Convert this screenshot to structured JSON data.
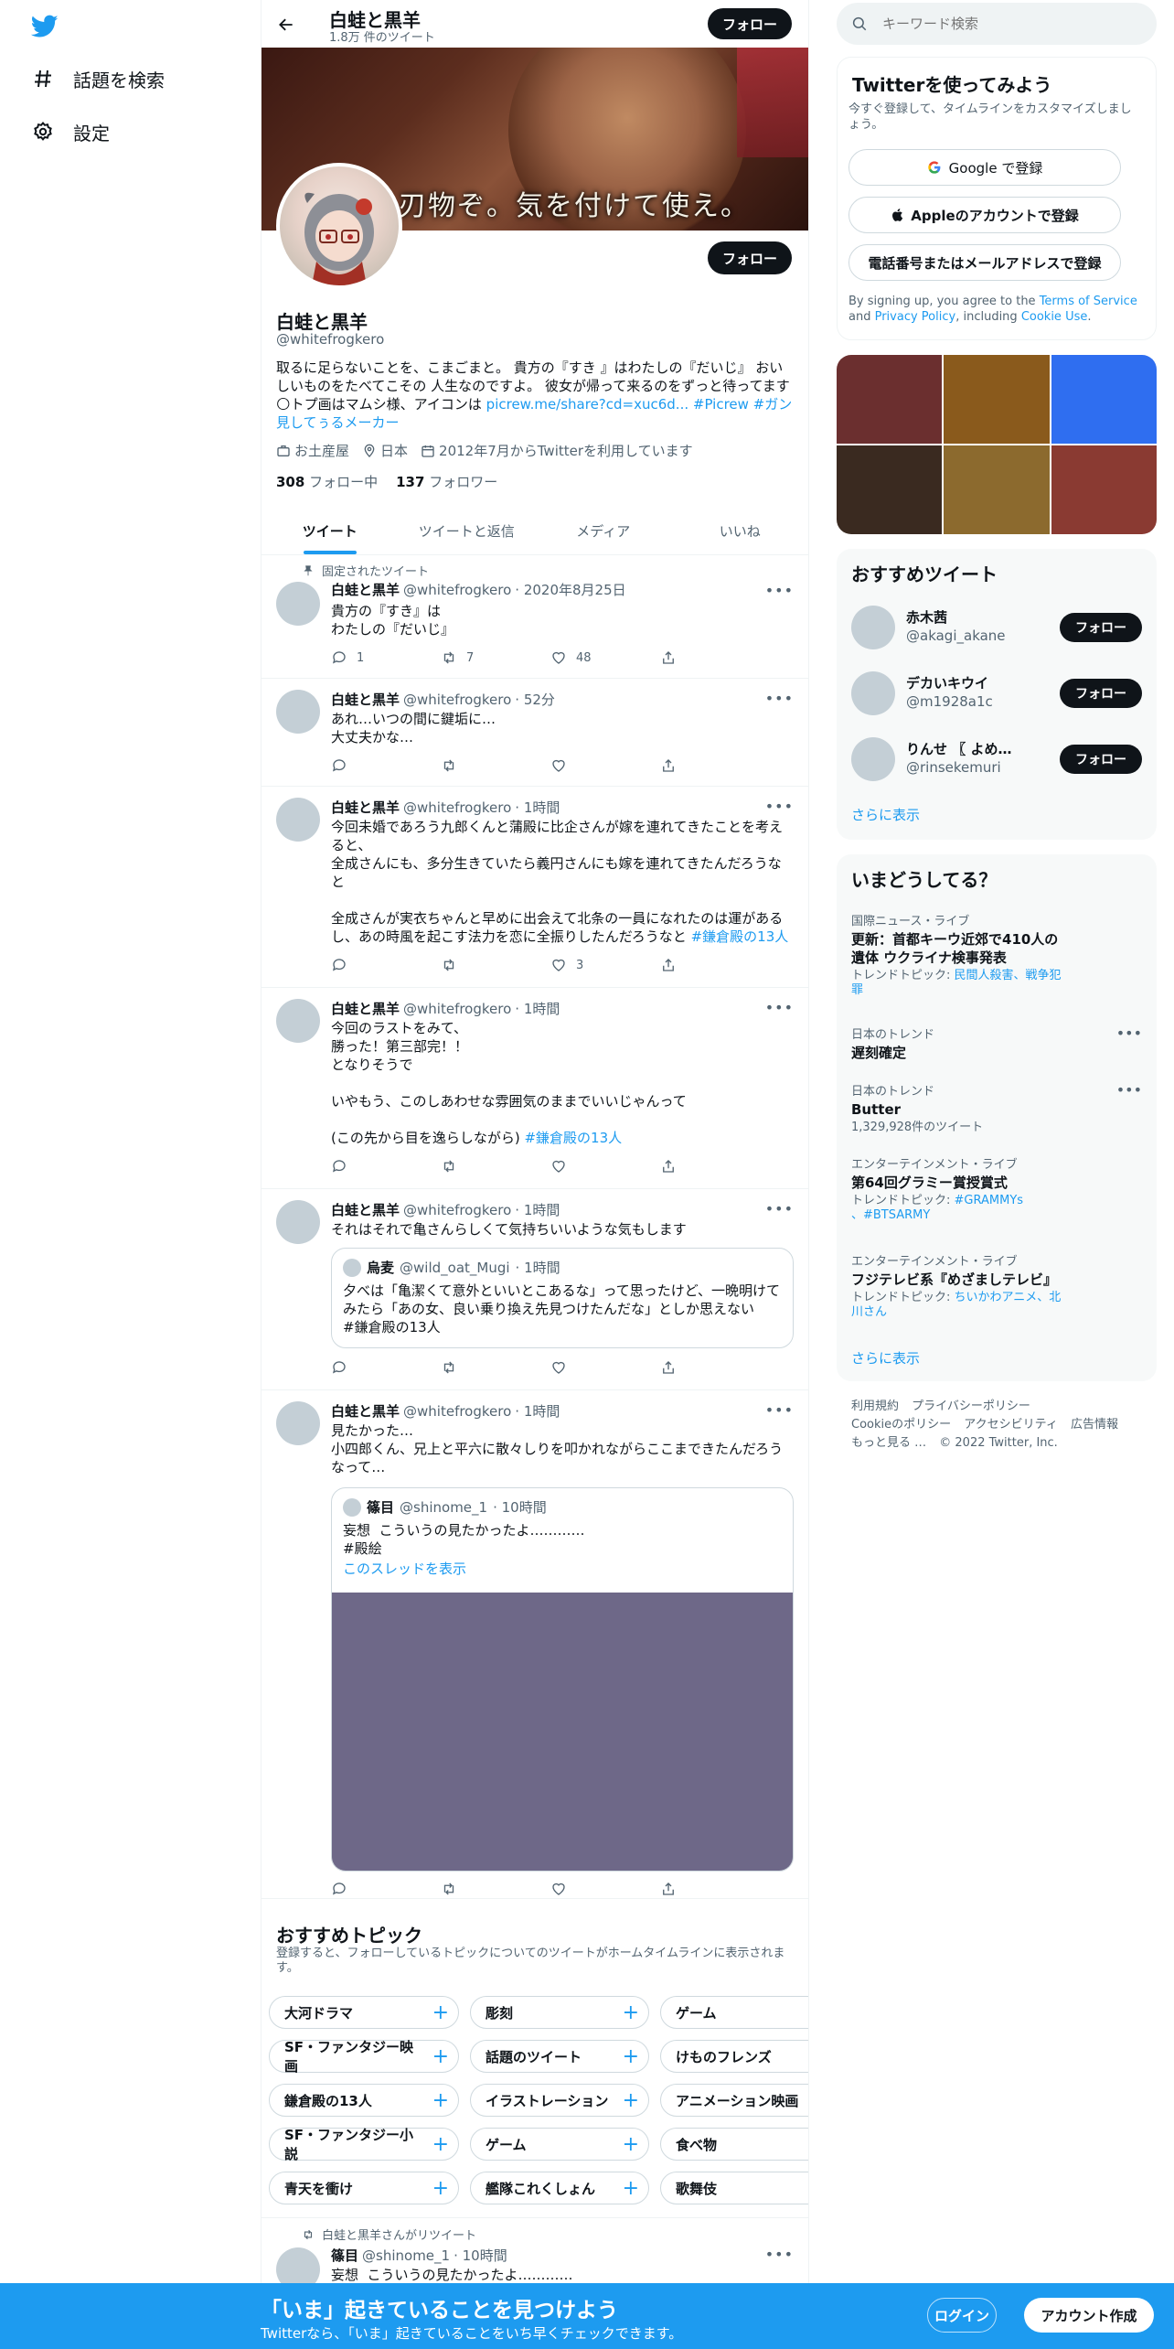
{
  "nav": {
    "explore": "話題を検索",
    "settings": "設定"
  },
  "header": {
    "name": "白蛙と黒羊",
    "tweet_count": "1.8万 件のツイート",
    "follow": "フォロー"
  },
  "banner": {
    "caption": "刃物ぞ。気を付けて使え。"
  },
  "profile": {
    "name": "白蛙と黒羊",
    "handle": "@whitefrogkero",
    "bio_text": "取るに足らないことを、こまごまと。 貴方の『すき 』はわたしの『だいじ』 おいしいものをたべてこその 人生なのですよ。 彼女が帰って来るのをずっと待ってます🌕トプ画はマムシ様、アイコンは ",
    "bio_link": "picrew.me/share?cd=xuc6d...",
    "bio_tags": " #Picrew #ガン見してぅるメーカー",
    "location_home": "お土産屋",
    "location": "日本",
    "joined": "2012年7月からTwitterを利用しています",
    "following_count": "308",
    "following_label": "フォロー中",
    "followers_count": "137",
    "followers_label": "フォロワー",
    "follow": "フォロー"
  },
  "tabs": [
    "ツイート",
    "ツイートと返信",
    "メディア",
    "いいね"
  ],
  "tweets": [
    {
      "context": "固定されたツイート",
      "name": "白蛙と黒羊",
      "handle": "@whitefrogkero",
      "time": "· 2020年8月25日",
      "text": "貴方の『すき』は\nわたしの『だいじ』",
      "reply": "1",
      "retweet": "7",
      "like": "48"
    },
    {
      "name": "白蛙と黒羊",
      "handle": "@whitefrogkero",
      "time": "· 52分",
      "text": "あれ…いつの間に鍵垢に…\n大丈夫かな…"
    },
    {
      "name": "白蛙と黒羊",
      "handle": "@whitefrogkero",
      "time": "· 1時間",
      "text": "今回未婚であろう九郎くんと蒲殿に比企さんが嫁を連れてきたことを考えると、\n全成さんにも、多分生きていたら義円さんにも嫁を連れてきたんだろうなと\n\n全成さんが実衣ちゃんと早めに出会えて北条の一員になれたのは運があるし、あの時風を起こす法力を恋に全振りしたんだろうなと ",
      "tag": "#鎌倉殿の13人",
      "like": "3"
    },
    {
      "name": "白蛙と黒羊",
      "handle": "@whitefrogkero",
      "time": "· 1時間",
      "text": "今回のラストをみて、\n勝った！第三部完！！\nとなりそうで\n\nいやもう、このしあわせな雰囲気のままでいいじゃんって\n\n(この先から目を逸らしながら) ",
      "tag": "#鎌倉殿の13人"
    },
    {
      "name": "白蛙と黒羊",
      "handle": "@whitefrogkero",
      "time": "· 1時間",
      "text": "それはそれで亀さんらしくて気持ちいいような気もします",
      "quote": {
        "name": "烏麦",
        "handle": "@wild_oat_Mugi",
        "time": "· 1時間",
        "text": "夕べは「亀潔くて意外といいとこあるな」って思ったけど、一晩明けてみたら「あの女、良い乗り換え先見つけたんだな」としか思えない\n#鎌倉殿の13人"
      }
    },
    {
      "name": "白蛙と黒羊",
      "handle": "@whitefrogkero",
      "time": "· 1時間",
      "text": "見たかった…\n小四郎くん、兄上と平六に散々しりを叩かれながらここまできたんだろうなって…",
      "quote": {
        "name": "篠目",
        "handle": "@shinome_1",
        "time": "· 10時間",
        "text": "妄想  こういうの見たかったよ…………\n#殿絵",
        "thread": "このスレッドを表示"
      }
    }
  ],
  "topics": {
    "title": "おすすめトピック",
    "subtitle": "登録すると、フォローしているトピックについてのツイートがホームタイムラインに表示されます。",
    "items": [
      "大河ドラマ",
      "彫刻",
      "ゲーム",
      "SF・ファンタジー映画",
      "話題のツイート",
      "けものフレンズ",
      "鎌倉殿の13人",
      "イラストレーション",
      "アニメーション映画",
      "SF・ファンタジー小説",
      "ゲーム",
      "食べ物",
      "青天を衝け",
      "艦隊これくしょん",
      "歌舞伎"
    ]
  },
  "retweet_teaser": {
    "context": "白蛙と黒羊さんがリツイート",
    "name": "篠目",
    "handle": "@shinome_1",
    "time": "· 10時間",
    "text": "妄想  こういうの見たかったよ…………"
  },
  "search": {
    "placeholder": "キーワード検索"
  },
  "signup_card": {
    "title": "Twitterを使ってみよう",
    "subtitle": "今すぐ登録して、タイムラインをカスタマイズしましょう。",
    "google": "Google で登録",
    "apple": "Appleのアカウントで登録",
    "phone": "電話番号またはメールアドレスで登録",
    "terms_pre": "By signing up, you agree to the ",
    "terms_link": "Terms of Service",
    "terms_mid": " and ",
    "privacy_link": "Privacy Policy",
    "terms_mid2": ", including ",
    "cookie_link": "Cookie Use",
    "terms_end": "."
  },
  "media_colors": [
    "#6b2f2f",
    "#8a5a1c",
    "#2f6ef0",
    "#3a2a20",
    "#8c6a2e",
    "#8a3a32"
  ],
  "recommended": {
    "title": "おすすめツイート",
    "users": [
      {
        "name": "赤木茜",
        "handle": "@akagi_akane"
      },
      {
        "name": "デカいキウイ",
        "handle": "@m1928a1c"
      },
      {
        "name": "りんせ 〖 よめ…",
        "handle": "@rinsekemuri"
      }
    ],
    "follow": "フォロー",
    "more": "さらに表示"
  },
  "trends": {
    "title": "いまどうしてる？",
    "items": [
      {
        "category": "国際ニュース・ライブ",
        "title": "更新：首都キーウ近郊で410人の遺体 ウクライナ検事発表",
        "sub_label": "トレンドトピック: ",
        "sub_links": "民間人殺害、戦争犯罪"
      },
      {
        "category": "日本のトレンド",
        "title": "遅刻確定"
      },
      {
        "category": "日本のトレンド",
        "title": "Butter",
        "count": "1,329,928件のツイート"
      },
      {
        "category": "エンターテインメント・ライブ",
        "title": "第64回グラミー賞授賞式",
        "sub_label": "トレンドトピック: ",
        "sub_links": "#GRAMMYs 、#BTSARMY"
      },
      {
        "category": "エンターテインメント・ライブ",
        "title": "フジテレビ系『めざましテレビ』",
        "sub_label": "トレンドトピック: ",
        "sub_links": "ちいかわアニメ、北川さん"
      }
    ],
    "more": "さらに表示"
  },
  "footer": {
    "links": [
      "利用規約",
      "プライバシーポリシー",
      "Cookieのポリシー",
      "アクセシビリティ",
      "広告情報",
      "もっと見る …"
    ],
    "copyright": "© 2022 Twitter, Inc."
  },
  "bottom_bar": {
    "title": "「いま」起きていることを見つけよう",
    "subtitle": "Twitterなら、「いま」起きていることをいち早くチェックできます。",
    "login": "ログイン",
    "signup": "アカウント作成"
  },
  "colors": {
    "accent": "#1d9bf0",
    "text": "#0f1419",
    "muted": "#536471",
    "dark_button": "#0f1419"
  }
}
